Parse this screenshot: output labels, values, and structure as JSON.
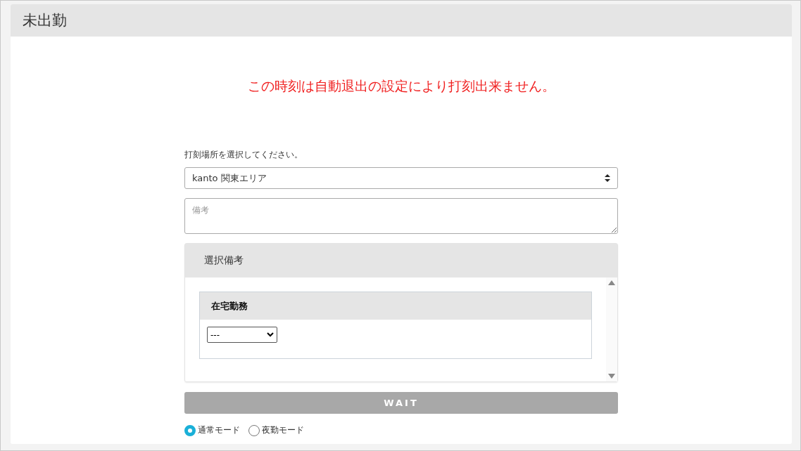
{
  "page": {
    "title": "未出勤"
  },
  "message": "この時刻は自動退出の設定により打刻出来ません。",
  "form": {
    "location_label": "打刻場所を選択してください。",
    "location_value": "kanto 関東エリア",
    "note_placeholder": "備考",
    "selection_panel": {
      "title": "選択備考",
      "groups": [
        {
          "title": "在宅勤務",
          "value": "---"
        }
      ]
    },
    "submit": {
      "label": "WAIT",
      "disabled": true
    },
    "modes": [
      {
        "label": "通常モード",
        "selected": true
      },
      {
        "label": "夜勤モード",
        "selected": false
      }
    ]
  }
}
